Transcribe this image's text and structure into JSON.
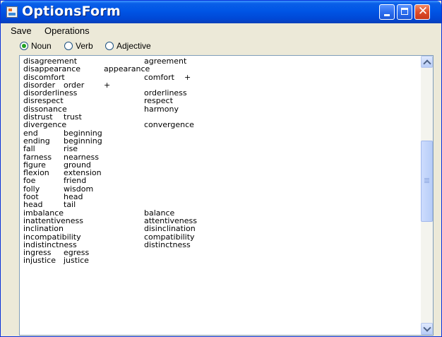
{
  "window": {
    "title": "OptionsForm"
  },
  "menu": [
    "Save",
    "Operations"
  ],
  "radios": [
    {
      "label": "Noun",
      "checked": true
    },
    {
      "label": "Verb",
      "checked": false
    },
    {
      "label": "Adjective",
      "checked": false
    }
  ],
  "list_items": [
    "disagreement\t\tagreement",
    "disappearance\tappearance",
    "discomfort\t\tcomfort\t+",
    "disorder\torder\t+",
    "disorderliness\t\torderliness",
    "disrespect\t\trespect",
    "dissonance\t\tharmony",
    "distrust\ttrust",
    "divergence\t\tconvergence",
    "end\tbeginning",
    "ending\tbeginning",
    "fall\trise",
    "farness\tnearness",
    "figure\tground",
    "flexion\textension",
    "foe\tfriend",
    "folly\twisdom",
    "foot\thead",
    "head\ttail",
    "imbalance\t\tbalance",
    "inattentiveness\t\tattentiveness",
    "inclination\t\tdisinclination",
    "incompatibility\t\tcompatibility",
    "indistinctness\t\tdistinctness",
    "ingress\tegress",
    "injustice\tjustice"
  ],
  "scrollbar": {
    "position_fraction": 0.42
  }
}
